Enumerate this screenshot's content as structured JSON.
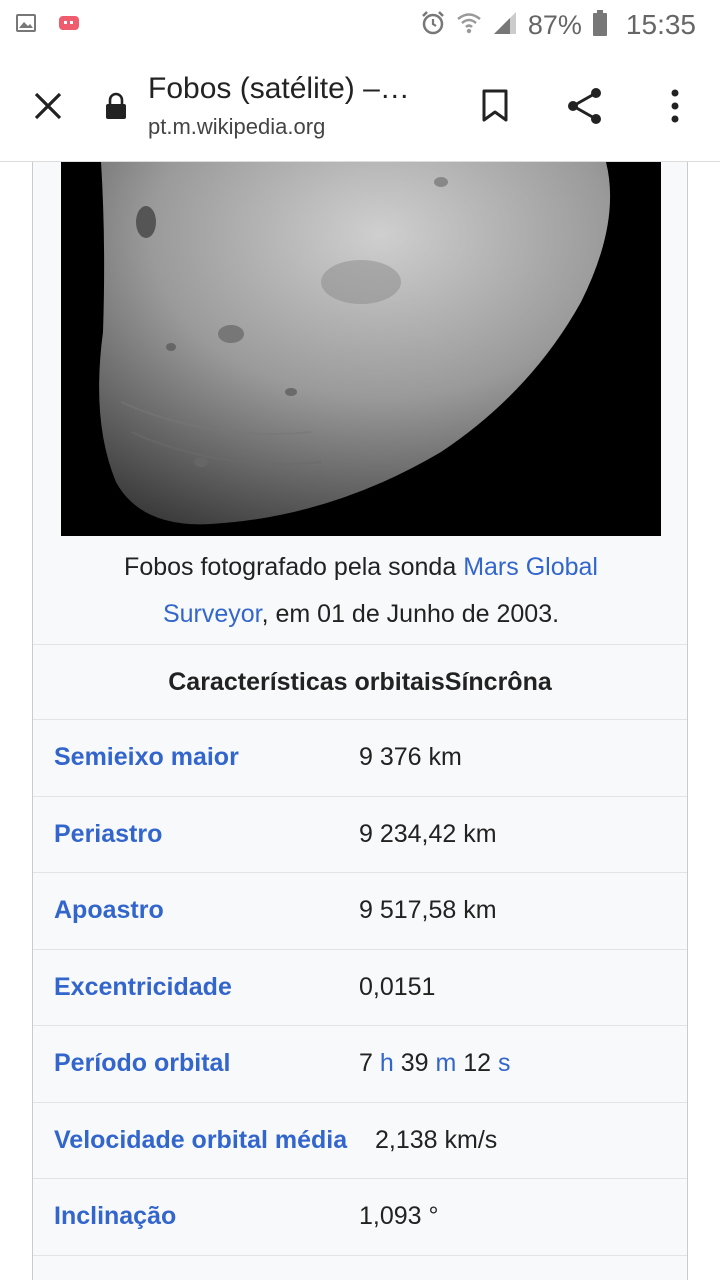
{
  "status_bar": {
    "battery_percent": "87%",
    "time": "15:35",
    "icons": [
      "gallery-icon",
      "notification-icon",
      "alarm-icon",
      "wifi-icon",
      "signal-icon",
      "battery-icon"
    ]
  },
  "app_bar": {
    "title": "Fobos (satélite) –…",
    "url": "pt.m.wikipedia.org",
    "icons": [
      "close-icon",
      "lock-icon",
      "bookmark-icon",
      "share-icon",
      "more-vert-icon"
    ]
  },
  "infobox": {
    "caption_prefix": "Fobos fotografado pela sonda ",
    "caption_link_1": "Mars Global",
    "caption_link_2": "Surveyor",
    "caption_suffix": ", em 01 de Junho de 2003.",
    "header": "Características orbitaisSíncrôna",
    "rows": [
      {
        "label": "Semieixo maior",
        "value": "9 376 km"
      },
      {
        "label": "Periastro",
        "value": "9 234,42 km"
      },
      {
        "label": "Apoastro",
        "value": "9 517,58 km"
      },
      {
        "label": "Excentricidade",
        "value": "0,0151"
      },
      {
        "label": "Período orbital",
        "value_parts": [
          "7",
          "h",
          "39",
          "m",
          "12",
          "s"
        ]
      },
      {
        "label": "Velocidade orbital média",
        "value": "2,138 km/s"
      },
      {
        "label": "Inclinação",
        "value": "1,093 °"
      }
    ]
  },
  "colors": {
    "link": "#3366cc",
    "infobox_bg": "#f8f9fa",
    "border": "#c8ccd1",
    "text": "#222222"
  }
}
